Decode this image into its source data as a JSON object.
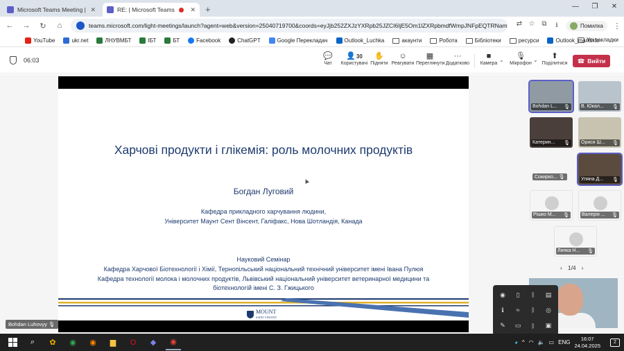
{
  "browser": {
    "tabs": [
      {
        "title": "Microsoft Teams Meeting | Mic",
        "active": false
      },
      {
        "title": "RE: | Microsoft Teams",
        "active": true,
        "recording": true
      }
    ],
    "url": "teams.microsoft.com/light-meetings/launch?agent=web&version=25040719700&coords=eyJjb252ZXJzYXRpb25JZCI6IjE5Om1lZXRpbmdfWmpJNFpEQTRNamt0WX...",
    "profile_label": "Помилка"
  },
  "bookmarks": {
    "items": [
      "YouTube",
      "ukr.net",
      "ЛНУВМБТ",
      "ІБТ",
      "БТ",
      "Facebook",
      "ChatGPT",
      "Google Перекладач",
      "Outlook_Luchka",
      "акаунти",
      "Робота",
      "Бібліотеки",
      "ресурси",
      "Outlook_markinfo"
    ],
    "all_label": "Усі закладки"
  },
  "toolbar": {
    "timer": "06:03",
    "chat": "Чат",
    "people": "Користувачі",
    "people_count": "30",
    "raise": "Підняти",
    "react": "Реагувати",
    "view": "Переглянути",
    "more": "Додатково",
    "camera": "Камера",
    "mic": "Мікрофон",
    "share": "Поділитися",
    "leave": "Вийти"
  },
  "slide": {
    "title": "Харчові продукти і глікемія: роль молочних продуктів",
    "author": "Богдан Луговий",
    "affil1": "Кафедра прикладного харчування людини,",
    "affil2": "Університет Маунт Сент Вінсент, Галіфакс, Нова Шотландія, Канада",
    "seminar": "Науковий Семінар",
    "dept1": "Кафедра Харчової Біотехнології і Хімії, Тернопільський національний технічний університет імені Івана Пулюя",
    "dept2": "Кафедра технології молока і молочних продуктів, Львівський національний університет ветеринарної медицини та",
    "dept3": "біотехнологій імені С. З. Гжицького",
    "logo_line1": "MOUNT",
    "logo_line2": "SAINT VINCENT"
  },
  "presenter_tag": "Bohdan Luhovyy",
  "participants": [
    {
      "name": "Bohdan L..."
    },
    {
      "name": "В. Юкал..."
    },
    {
      "name": "Катерин..."
    },
    {
      "name": "Орися Ш..."
    },
    {
      "name": "Сокирко..."
    },
    {
      "name": "Уляна Д..."
    },
    {
      "name": "Рішко М..."
    },
    {
      "name": "Валерія ..."
    },
    {
      "name": "Липка Н..."
    }
  ],
  "pager": {
    "label": "1/4"
  },
  "taskbar": {
    "lang": "ENG",
    "time": "16:07",
    "date": "24.04.2025",
    "notif_count": "2"
  },
  "colors": {
    "slide_text": "#1d3a6e",
    "leave": "#c4314b",
    "accent": "#5b5fc7"
  }
}
